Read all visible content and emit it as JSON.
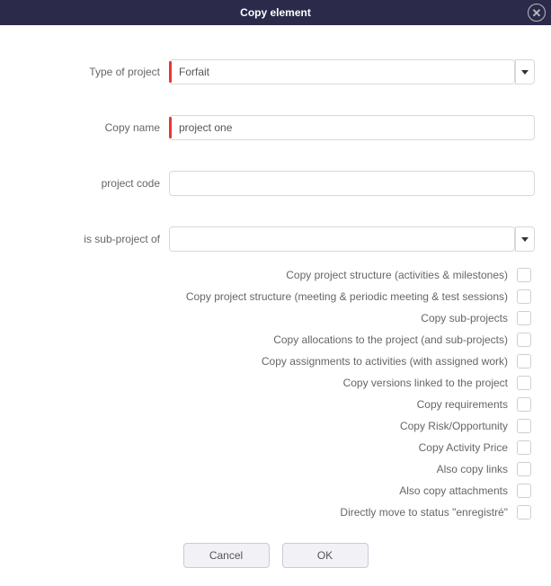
{
  "dialog": {
    "title": "Copy element"
  },
  "form": {
    "labels": {
      "type_of_project": "Type of project",
      "copy_name": "Copy name",
      "project_code": "project code",
      "sub_project_of": "is sub-project of"
    },
    "values": {
      "type_of_project": "Forfait",
      "copy_name": "project one",
      "project_code": "",
      "sub_project_of": ""
    }
  },
  "checks": [
    {
      "label": "Copy project structure (activities & milestones)",
      "checked": false
    },
    {
      "label": "Copy project structure (meeting & periodic meeting & test sessions)",
      "checked": false
    },
    {
      "label": "Copy sub-projects",
      "checked": false
    },
    {
      "label": "Copy allocations to the project (and sub-projects)",
      "checked": false
    },
    {
      "label": "Copy assignments to activities (with assigned work)",
      "checked": false
    },
    {
      "label": "Copy versions linked to the project",
      "checked": false
    },
    {
      "label": "Copy requirements",
      "checked": false
    },
    {
      "label": "Copy Risk/Opportunity",
      "checked": false
    },
    {
      "label": "Copy Activity Price",
      "checked": false
    },
    {
      "label": "Also copy links",
      "checked": false
    },
    {
      "label": "Also copy attachments",
      "checked": false
    },
    {
      "label": "Directly move to status \"enregistré\"",
      "checked": false
    }
  ],
  "buttons": {
    "cancel": "Cancel",
    "ok": "OK"
  }
}
